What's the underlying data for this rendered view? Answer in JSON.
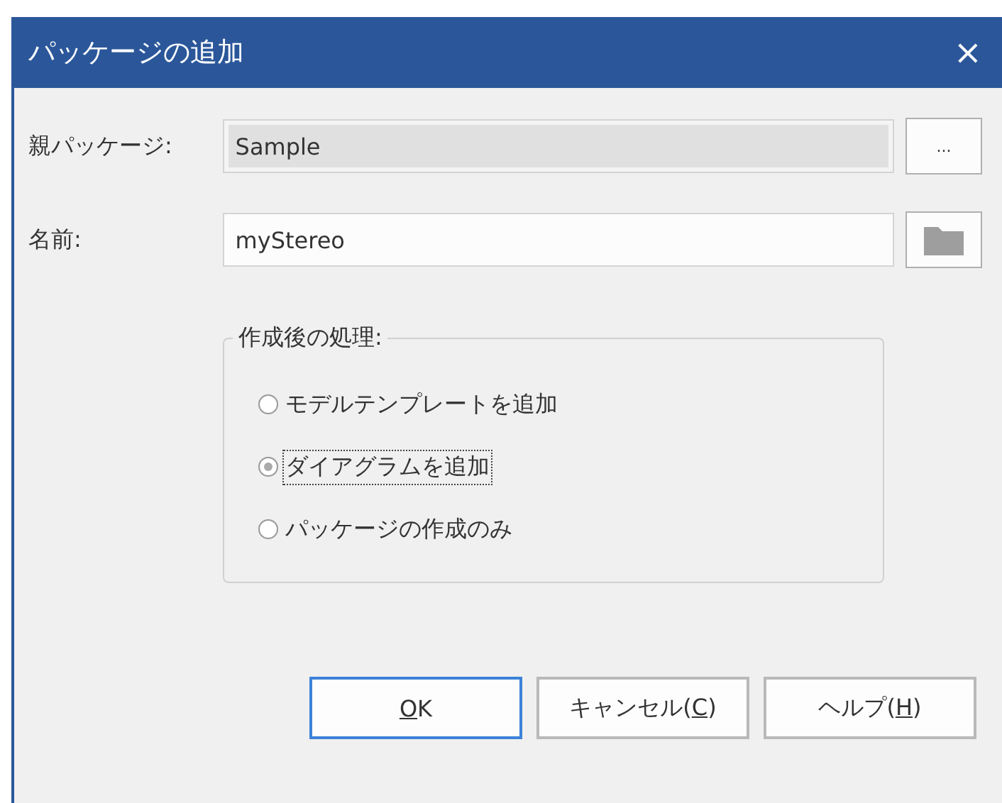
{
  "window": {
    "title": "パッケージの追加",
    "close": "×"
  },
  "fields": [
    {
      "label": "親パッケージ:",
      "value": "Sample",
      "readonly": true,
      "button": {
        "kind": "ellipsis",
        "text": "..."
      }
    },
    {
      "label": "名前:",
      "value": "myStereo",
      "readonly": false,
      "button": {
        "kind": "folder"
      }
    }
  ],
  "group": {
    "title": "作成後の処理:",
    "options": [
      {
        "label": "モデルテンプレートを追加",
        "selected": false,
        "focused": false
      },
      {
        "label": "ダイアグラムを追加",
        "selected": true,
        "focused": true
      },
      {
        "label": "パッケージの作成のみ",
        "selected": false,
        "focused": false
      }
    ]
  },
  "buttons": [
    {
      "key": "O",
      "after": "K",
      "default": true
    },
    {
      "before": "キャンセル(",
      "key": "C",
      "after": ")",
      "default": false
    },
    {
      "before": "ヘルプ(",
      "key": "H",
      "after": ")",
      "default": false
    }
  ]
}
